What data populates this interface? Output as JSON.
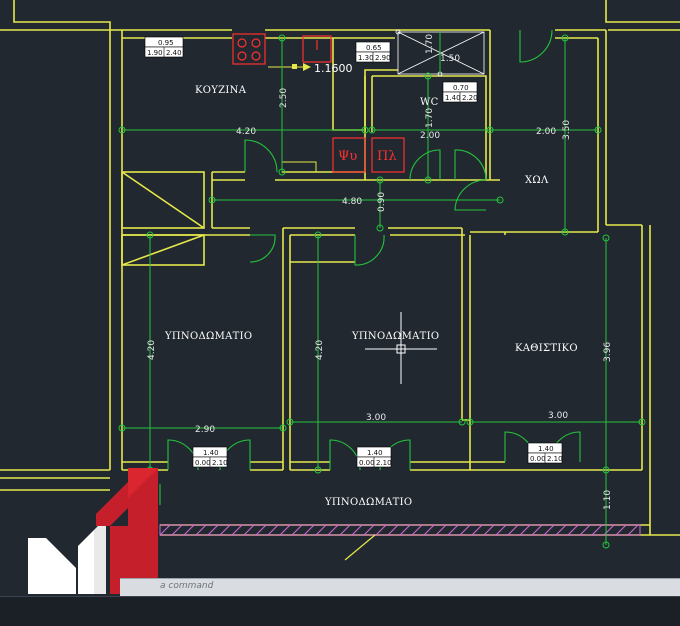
{
  "rooms": {
    "kitchen": "ΚΟΥΖΙΝΑ",
    "wc": "WC",
    "hall": "ΧΩΛ",
    "bedroom_left": "ΥΠΝΟΔΩΜΑΤΙΟ",
    "bedroom_center": "ΥΠΝΟΔΩΜΑΤΙΟ",
    "living": "ΚΑΘΙΣΤΙΚΟ",
    "bedroom_bottom": "ΥΠΝΟΔΩΜΑΤΙΟ"
  },
  "dimensions": {
    "kitchen_width": "4.20",
    "kitchen_height": "2.50",
    "wc_width": "2.00",
    "wc_height": "1.70",
    "wc_top": "1.70",
    "wc_side": "1.50",
    "hall_width": "2.00",
    "hall_height": "3.50",
    "corridor_width": "4.80",
    "corridor_height": "0.90",
    "bedroom_left_height": "4.20",
    "bedroom_left_width": "2.90",
    "bedroom_center_height": "4.20",
    "bedroom_center_width": "3.00",
    "living_width": "3.00",
    "living_height": "3.96",
    "bottom_height": "1.10"
  },
  "measure_label": "1.1600",
  "window_tags": [
    {
      "top": "0.95",
      "left": "1.90",
      "right": "2.40"
    },
    {
      "top": "0.65",
      "left": "1.30",
      "right": "2.90"
    },
    {
      "top": "0.70",
      "left": "1.40",
      "right": "2.20"
    },
    {
      "top": "1.40",
      "left": "0.00",
      "right": "2.10"
    },
    {
      "top": "1.40",
      "left": "0.00",
      "right": "2.10"
    },
    {
      "top": "1.40",
      "left": "0.00",
      "right": "2.10"
    }
  ],
  "fixtures": {
    "water_heater": "Ψυ",
    "washer": "Πλ"
  },
  "command_prompt": "a command",
  "colors": {
    "background": "#212830",
    "walls": "#e6e84a",
    "dimensions": "#25c43c",
    "fixtures": "#ff3030",
    "hatch": "#d46ad8"
  }
}
